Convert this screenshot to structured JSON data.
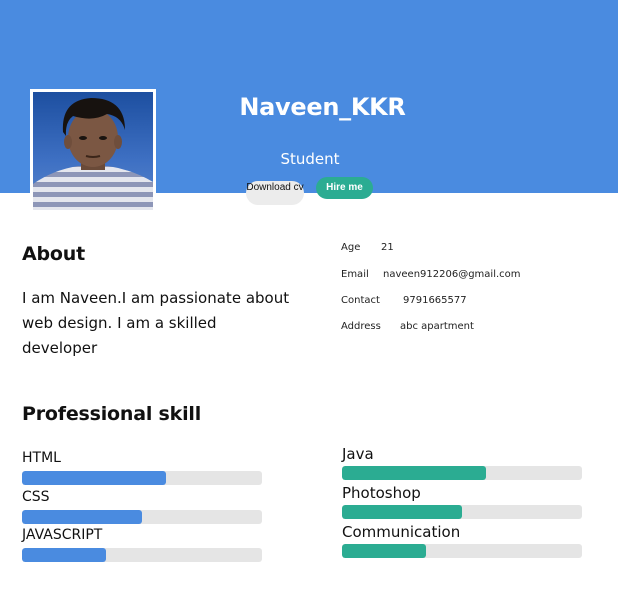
{
  "profile": {
    "name": "Naveen_KKR",
    "role": "Student",
    "download_label": "Download cv",
    "hire_label": "Hire me"
  },
  "about": {
    "title": "About",
    "text": "I am Naveen.I am passionate about web design. I am a skilled developer"
  },
  "info": {
    "age": {
      "label": "Age",
      "value": "21"
    },
    "email": {
      "label": "Email",
      "value": "naveen912206@gmail.com"
    },
    "contact": {
      "label": "Contact",
      "value": "9791665577"
    },
    "address": {
      "label": "Address",
      "value": "abc apartment"
    }
  },
  "skills": {
    "title": "Professional skill",
    "left": [
      {
        "name": "HTML",
        "level": 0.6
      },
      {
        "name": "CSS",
        "level": 0.5
      },
      {
        "name": "JAVASCRIPT",
        "level": 0.35
      }
    ],
    "right": [
      {
        "name": "Java",
        "level": 0.6
      },
      {
        "name": "Photoshop",
        "level": 0.5
      },
      {
        "name": "Communication",
        "level": 0.35
      }
    ]
  },
  "colors": {
    "banner": "#4a8be0",
    "accent_green": "#2bac92",
    "bar_track": "#e5e5e5"
  }
}
